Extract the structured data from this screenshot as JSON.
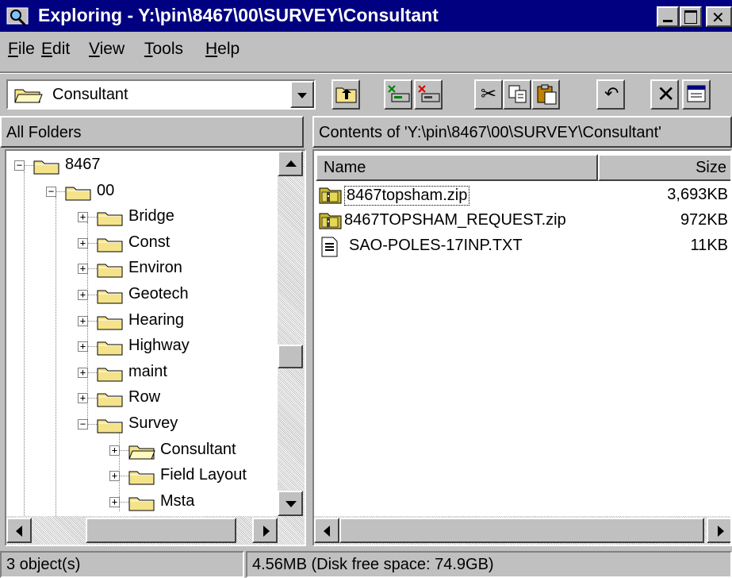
{
  "window": {
    "title": "Exploring - Y:\\pin\\8467\\00\\SURVEY\\Consultant"
  },
  "menu": [
    {
      "label": "File"
    },
    {
      "label": "Edit"
    },
    {
      "label": "View"
    },
    {
      "label": "Tools"
    },
    {
      "label": "Help"
    }
  ],
  "toolbar": {
    "address_value": "Consultant",
    "buttons": [
      "up-one-level-icon",
      "map-drive-icon",
      "disconnect-drive-icon",
      "cut-icon",
      "copy-icon",
      "paste-icon",
      "undo-icon",
      "delete-icon",
      "properties-icon"
    ]
  },
  "tree_pane": {
    "header": "All Folders",
    "items": [
      {
        "label": "8467",
        "expander": "−"
      },
      {
        "label": "00",
        "expander": "−"
      },
      {
        "label": "Bridge",
        "expander": "+"
      },
      {
        "label": "Const",
        "expander": "+"
      },
      {
        "label": "Environ",
        "expander": "+"
      },
      {
        "label": "Geotech",
        "expander": "+"
      },
      {
        "label": "Hearing",
        "expander": "+"
      },
      {
        "label": "Highway",
        "expander": "+"
      },
      {
        "label": "maint",
        "expander": "+"
      },
      {
        "label": "Row",
        "expander": "+"
      },
      {
        "label": "Survey",
        "expander": "−"
      },
      {
        "label": "Consultant",
        "expander": "+"
      },
      {
        "label": "Field Layout",
        "expander": "+"
      },
      {
        "label": "Msta",
        "expander": "+"
      }
    ]
  },
  "contents_pane": {
    "header": "Contents of 'Y:\\pin\\8467\\00\\SURVEY\\Consultant'",
    "columns": {
      "name": "Name",
      "size": "Size"
    },
    "files": [
      {
        "name": "8467topsham.zip",
        "size": "3,693KB",
        "icon": "zip-folder-icon"
      },
      {
        "name": "8467TOPSHAM_REQUEST.zip",
        "size": "972KB",
        "icon": "zip-folder-icon"
      },
      {
        "name": "SAO-POLES-17INP.TXT",
        "size": "11KB",
        "icon": "text-file-icon"
      }
    ]
  },
  "status": {
    "objects": "3 object(s)",
    "disk": "4.56MB (Disk free space: 74.9GB)"
  },
  "colors": {
    "title_bar": "#000080",
    "face": "#c0c0c0",
    "folder": "#f4e38a"
  }
}
